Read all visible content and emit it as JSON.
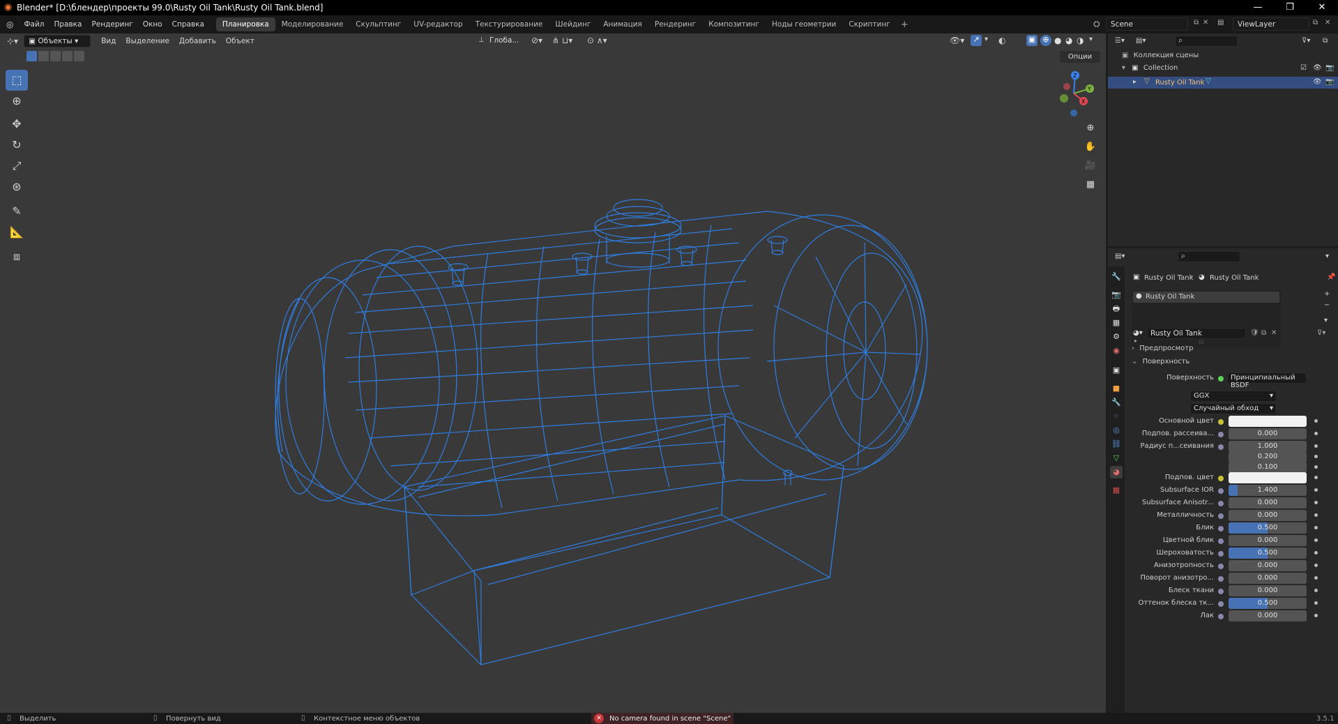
{
  "window": {
    "title": "Blender* [D:\\блендер\\проекты 99.0\\Rusty Oil Tank\\Rusty Oil Tank.blend]"
  },
  "menus": [
    "Файл",
    "Правка",
    "Рендеринг",
    "Окно",
    "Справка"
  ],
  "workspaces": [
    "Планировка",
    "Моделирование",
    "Скульптинг",
    "UV-редактор",
    "Текстурирование",
    "Шейдинг",
    "Анимация",
    "Рендеринг",
    "Композитинг",
    "Ноды геометрии",
    "Скриптинг"
  ],
  "active_workspace": "Планировка",
  "scene": "Scene",
  "view_layer": "ViewLayer",
  "viewport": {
    "mode": "Объекты",
    "menus": [
      "Вид",
      "Выделение",
      "Добавить",
      "Объект"
    ],
    "transform": "Глоба...",
    "options": "Опции",
    "gizmo_labels": {
      "x": "X",
      "y": "Y",
      "z": "Z"
    }
  },
  "outliner": {
    "root": "Коллекция сцены",
    "collection": "Collection",
    "object": "Rusty Oil Tank"
  },
  "properties": {
    "breadcrumb_object": "Rusty Oil Tank",
    "breadcrumb_material": "Rusty Oil Tank",
    "slot": "Rusty Oil Tank",
    "material_name": "Rusty Oil Tank",
    "panel_preview": "Предпросмотр",
    "panel_surface": "Поверхность",
    "surface_label": "Поверхность",
    "surface_value": "Принципиальный BSDF",
    "distribution": "GGX",
    "subsurface_method": "Случайный обход",
    "rows": [
      {
        "label": "Основной цвет",
        "type": "color",
        "color": "#f2f2f2"
      },
      {
        "label": "Подпов. рассеива...",
        "value": "0.000",
        "fill": 0
      },
      {
        "label": "Радиус п...сеивания",
        "value": "1.000",
        "fill": 0
      },
      {
        "label": "",
        "value": "0.200",
        "fill": 0
      },
      {
        "label": "",
        "value": "0.100",
        "fill": 0
      },
      {
        "label": "Подпов. цвет",
        "type": "color",
        "color": "#f2f2f2"
      },
      {
        "label": "Subsurface IOR",
        "value": "1.400",
        "fill": 0.12
      },
      {
        "label": "Subsurface Anisotr...",
        "value": "0.000",
        "fill": 0
      },
      {
        "label": "Металличность",
        "value": "0.000",
        "fill": 0
      },
      {
        "label": "Блик",
        "value": "0.500",
        "fill": 0.5
      },
      {
        "label": "Цветной блик",
        "value": "0.000",
        "fill": 0
      },
      {
        "label": "Шероховатость",
        "value": "0.500",
        "fill": 0.5
      },
      {
        "label": "Анизотропность",
        "value": "0.000",
        "fill": 0
      },
      {
        "label": "Поворот анизотро...",
        "value": "0.000",
        "fill": 0
      },
      {
        "label": "Блеск ткани",
        "value": "0.000",
        "fill": 0
      },
      {
        "label": "Оттенок блеска тк...",
        "value": "0.500",
        "fill": 0.5
      },
      {
        "label": "Лак",
        "value": "0.000",
        "fill": 0
      }
    ]
  },
  "statusbar": {
    "select": "Выделить",
    "rotate": "Повернуть вид",
    "context": "Контекстное меню объектов",
    "warning": "No camera found in scene \"Scene\"",
    "version": "3.5.1"
  },
  "colors": {
    "accent": "#4772b3",
    "wire": "#2f7de0",
    "viewport_bg": "#393939"
  }
}
